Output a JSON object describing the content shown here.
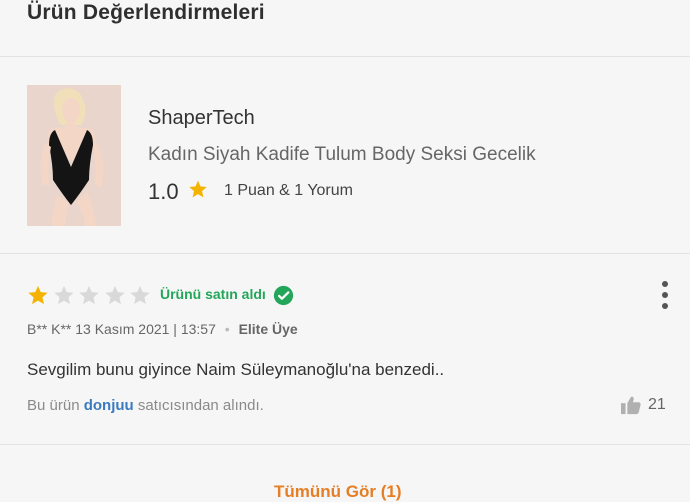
{
  "header": {
    "title": "Ürün Değerlendirmeleri"
  },
  "product": {
    "brand": "ShaperTech",
    "name": "Kadın Siyah Kadife Tulum Body Seksi Gecelik",
    "average_rating": "1.0",
    "rating_summary": "1 Puan & 1 Yorum",
    "image_icon": "product-photo"
  },
  "review": {
    "stars_filled": 1,
    "stars_total": 5,
    "verified_label": "Ürünü satın aldı",
    "author": "B** K**",
    "date": "13 Kasım 2021 | 13:57",
    "badge": "Elite Üye",
    "comment": "Sevgilim bunu giyince Naim Süleymanoğlu'na benzedi..",
    "seller_prefix": "Bu ürün",
    "seller_name": "donjuu",
    "seller_suffix": "satıcısından alındı.",
    "like_count": "21"
  },
  "footer": {
    "see_all_label": "Tümünü Gör (1)"
  },
  "colors": {
    "star_filled": "#f5b301",
    "star_empty": "#d9d9d9",
    "verified": "#23a65a",
    "seller_link": "#3a7bbf",
    "accent": "#e57e25"
  }
}
